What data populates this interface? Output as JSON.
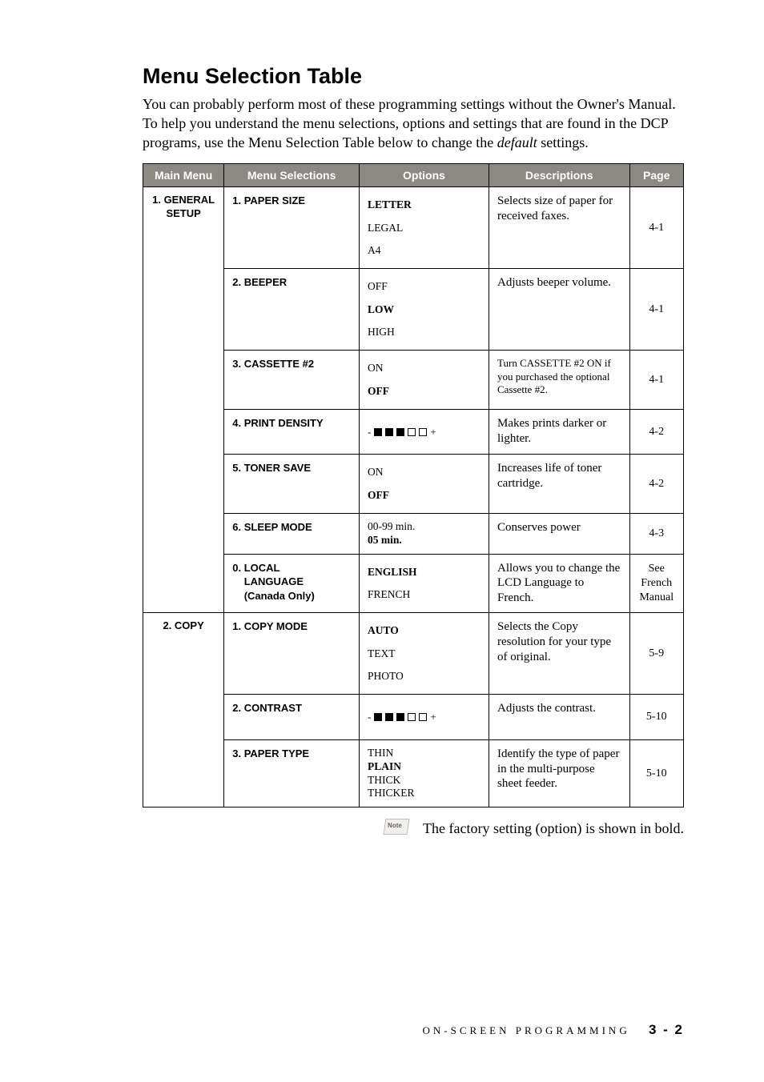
{
  "heading": "Menu Selection Table",
  "intro_parts": {
    "a": "You can probably perform most of these programming settings without the Owner's Manual. To help you understand the menu selections, options and settings that are found in the DCP programs, use the Menu Selection Table below to change the ",
    "italic": "default",
    "b": " settings."
  },
  "table": {
    "headers": {
      "main_menu": "Main Menu",
      "menu_selections": "Menu Selections",
      "options": "Options",
      "descriptions": "Descriptions",
      "page": "Page"
    },
    "groups": [
      {
        "main_menu": "1. GENERAL SETUP",
        "rows": [
          {
            "selection": "1. PAPER SIZE",
            "options": [
              {
                "label": "LETTER",
                "bold": true
              },
              {
                "label": "LEGAL",
                "bold": false
              },
              {
                "label": "A4",
                "bold": false
              }
            ],
            "description": "Selects size of paper for received faxes.",
            "page": "4-1",
            "kind": "list"
          },
          {
            "selection": "2. BEEPER",
            "options": [
              {
                "label": "OFF",
                "bold": false
              },
              {
                "label": "LOW",
                "bold": true
              },
              {
                "label": "HIGH",
                "bold": false
              }
            ],
            "description": "Adjusts beeper volume.",
            "page": "4-1",
            "kind": "list"
          },
          {
            "selection": "3. CASSETTE #2",
            "options": [
              {
                "label": "ON",
                "bold": false
              },
              {
                "label": "OFF",
                "bold": true
              }
            ],
            "description": "Turn CASSETTE #2 ON if you purchased the optional Cassette #2.",
            "desc_small": true,
            "page": "4-1",
            "kind": "list"
          },
          {
            "selection": "4. PRINT DENSITY",
            "options": [],
            "description": "Makes prints darker or lighter.",
            "page": "4-2",
            "kind": "density"
          },
          {
            "selection": "5. TONER SAVE",
            "options": [
              {
                "label": "ON",
                "bold": false
              },
              {
                "label": "OFF",
                "bold": true
              }
            ],
            "description": "Increases life of toner cartridge.",
            "page": "4-2",
            "kind": "list"
          },
          {
            "selection": "6. SLEEP MODE",
            "options": [
              {
                "label": "00-99 min.",
                "bold": false
              },
              {
                "label": "05 min.",
                "bold": true
              }
            ],
            "description": "Conserves power",
            "page": "4-3",
            "kind": "list",
            "tight": true
          },
          {
            "selection": "0. LOCAL LANGUAGE (Canada Only)",
            "options": [
              {
                "label": "ENGLISH",
                "bold": true
              },
              {
                "label": "FRENCH",
                "bold": false
              }
            ],
            "description": "Allows you to change the LCD Language to French.",
            "page": "See French Manual",
            "kind": "list"
          }
        ]
      },
      {
        "main_menu": "2. COPY",
        "rows": [
          {
            "selection": "1. COPY MODE",
            "options": [
              {
                "label": "AUTO",
                "bold": true
              },
              {
                "label": "TEXT",
                "bold": false
              },
              {
                "label": "PHOTO",
                "bold": false
              }
            ],
            "description": "Selects the Copy resolution for your type of original.",
            "page": "5-9",
            "kind": "list"
          },
          {
            "selection": "2. CONTRAST",
            "options": [],
            "description": "Adjusts the contrast.",
            "page": "5-10",
            "kind": "density"
          },
          {
            "selection": "3. PAPER TYPE",
            "options": [
              {
                "label": "THIN",
                "bold": false
              },
              {
                "label": "PLAIN",
                "bold": true
              },
              {
                "label": "THICK",
                "bold": false
              },
              {
                "label": "THICKER",
                "bold": false
              }
            ],
            "description": "Identify the type of paper in the multi-purpose sheet feeder.",
            "page": "5-10",
            "kind": "list",
            "tight": true
          }
        ]
      }
    ]
  },
  "note_text": "The factory setting (option) is shown in bold.",
  "note_badge": "Note",
  "footer": {
    "section": "ON-SCREEN PROGRAMMING",
    "page": "3 - 2"
  }
}
